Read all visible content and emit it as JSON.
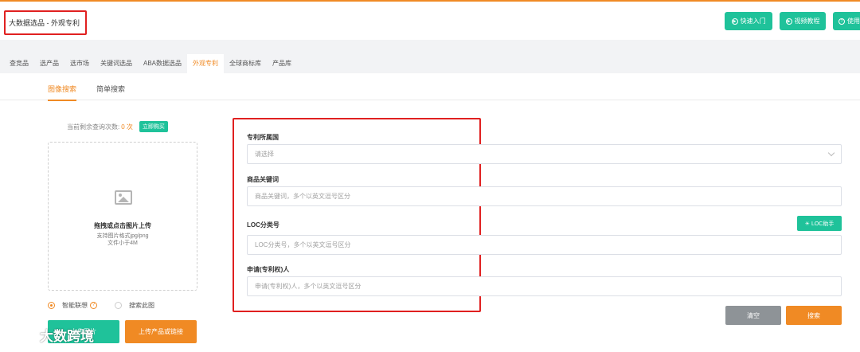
{
  "colors": {
    "accent": "#f08a24",
    "green": "#1fc29a",
    "red_highlight": "#e02020",
    "gray_button": "#8e9397"
  },
  "header": {
    "title": "大数据选品 - 外观专利",
    "buttons": [
      {
        "label": "快速入门",
        "icon": "play-circle-icon"
      },
      {
        "label": "视频教程",
        "icon": "play-circle-icon"
      },
      {
        "label": "使用",
        "icon": "help-circle-icon"
      }
    ]
  },
  "nav_tabs": [
    "查竞品",
    "选产品",
    "选市场",
    "关键词选品",
    "ABA数据选品",
    "外观专利",
    "全球商标库",
    "产品库"
  ],
  "nav_active": "外观专利",
  "sub_tabs": [
    "图像搜索",
    "简单搜索"
  ],
  "sub_active": "图像搜索",
  "quota": {
    "label": "当前剩余查询次数:",
    "count": "0 次",
    "buy_label": "立即购买"
  },
  "upload": {
    "main_text": "拖拽或点击图片上传",
    "formats": "支持图片格式jpg/png",
    "size_limit": "文件小于4M"
  },
  "radio_options": [
    {
      "label": "智能联想",
      "selected": true
    },
    {
      "label": "搜索此图",
      "selected": false
    }
  ],
  "left_buttons": {
    "upload_image": "上传图片",
    "upload_link": "上传产品或链接"
  },
  "form": {
    "country": {
      "label": "专利所属国",
      "placeholder": "请选择"
    },
    "keywords": {
      "label": "商品关键词",
      "placeholder": "商品关键词，多个以英文逗号区分"
    },
    "loc": {
      "label": "LOC分类号",
      "placeholder": "LOC分类号，多个以英文逗号区分",
      "helper_label": "LOC助手"
    },
    "applicant": {
      "label": "申请(专利权)人",
      "placeholder": "申请(专利权)人，多个以英文逗号区分"
    }
  },
  "actions": {
    "clear": "清空",
    "search": "搜索"
  },
  "watermark": {
    "text": "大数跨境",
    "logo": "watermark-logo"
  }
}
